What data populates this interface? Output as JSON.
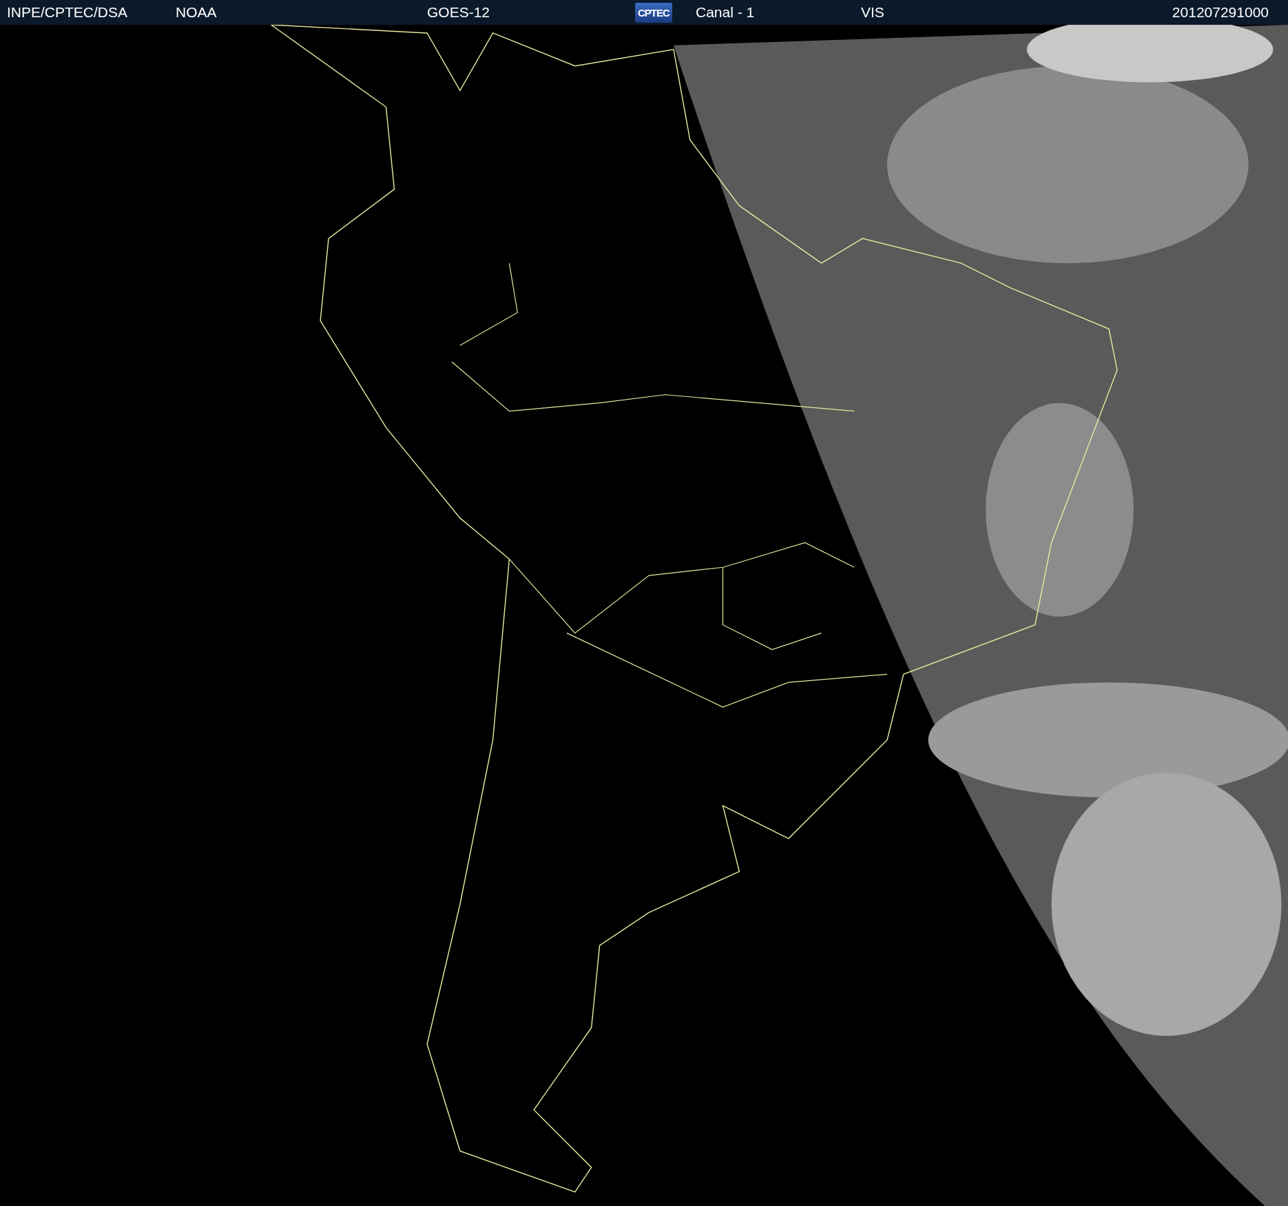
{
  "header": {
    "items": [
      {
        "kind": "text",
        "text": "INPE/CPTEC/DSA"
      },
      {
        "kind": "text",
        "text": "NOAA"
      },
      {
        "kind": "text",
        "text": "GOES-12"
      },
      {
        "kind": "logo",
        "text": "CPTEC"
      },
      {
        "kind": "text",
        "text": "Canal - 1"
      },
      {
        "kind": "text",
        "text": "VIS"
      },
      {
        "kind": "text",
        "text": "201207291000"
      }
    ]
  }
}
